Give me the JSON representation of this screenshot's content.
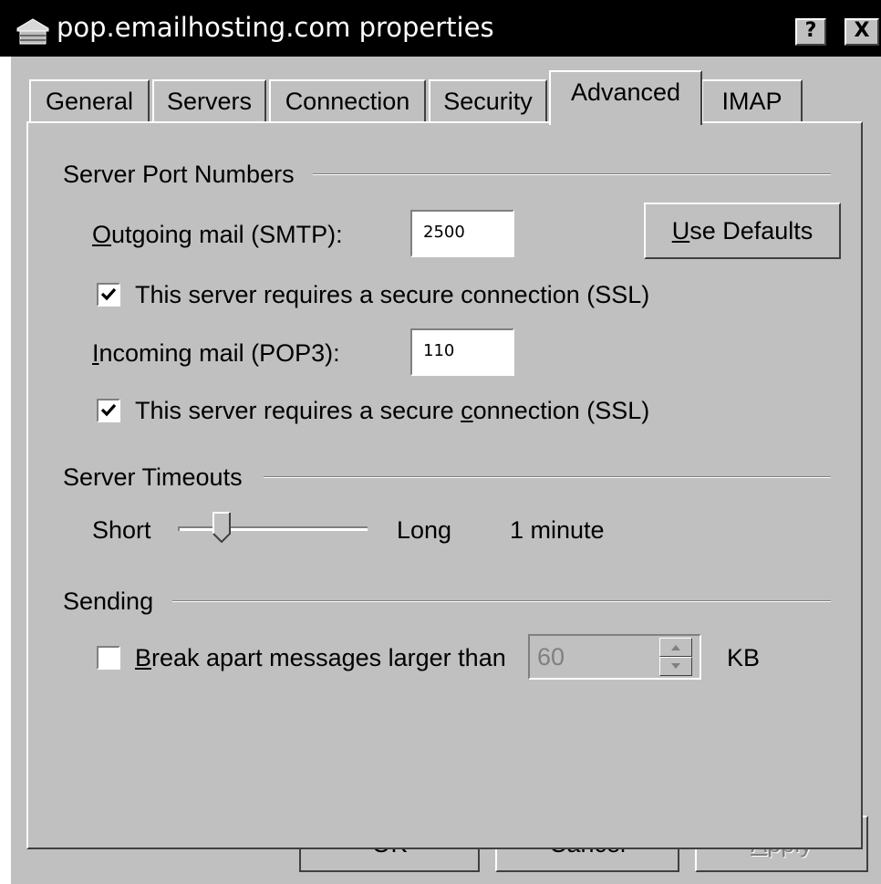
{
  "window": {
    "title": "pop.emailhosting.com properties",
    "help_label": "?",
    "close_label": "X"
  },
  "tabs": [
    {
      "label": "General",
      "active": false
    },
    {
      "label": "Servers",
      "active": false
    },
    {
      "label": "Connection",
      "active": false
    },
    {
      "label": "Security",
      "active": false
    },
    {
      "label": "Advanced",
      "active": true
    },
    {
      "label": "IMAP",
      "active": false
    }
  ],
  "server_ports": {
    "group_label": "Server Port Numbers",
    "outgoing": {
      "label_mnemonic": "O",
      "label_rest": "utgoing mail (SMTP):",
      "value": "2500"
    },
    "use_defaults": {
      "mnemonic": "U",
      "rest": "se Defaults"
    },
    "outgoing_ssl": {
      "checked": true,
      "label": "This server requires a secure connection (SSL)"
    },
    "incoming": {
      "label_mnemonic": "I",
      "label_rest": "ncoming mail (POP3):",
      "value": "110"
    },
    "incoming_ssl": {
      "checked": true,
      "label_before": "This server requires a secure ",
      "label_mnemonic": "c",
      "label_after": "onnection (SSL)"
    }
  },
  "timeouts": {
    "group_label": "Server Timeouts",
    "short_label": "Short",
    "long_label": "Long",
    "value_label": "1 minute",
    "slider_level": 0.2
  },
  "sending": {
    "group_label": "Sending",
    "break_apart": {
      "checked": false,
      "label_mnemonic": "B",
      "label_rest": "reak apart messages larger than"
    },
    "size_value": "60",
    "unit": "KB"
  },
  "buttons": {
    "ok": "OK",
    "cancel": "Cancel",
    "apply_mnemonic": "A",
    "apply_rest": "pply"
  },
  "colors": {
    "face": "#c0c0c0",
    "titlebar": "#000000",
    "disabled_text": "#808080"
  },
  "icons": {
    "title": "mail-server-icon",
    "help": "help-icon",
    "close": "close-icon",
    "check": "check-icon",
    "spin_up": "spin-up-icon",
    "spin_down": "spin-down-icon"
  }
}
